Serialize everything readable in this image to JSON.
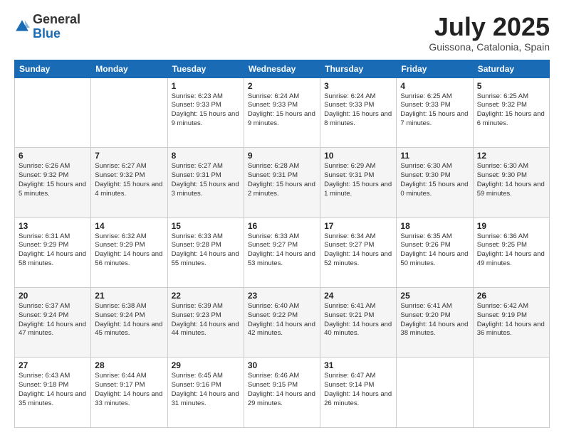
{
  "logo": {
    "general": "General",
    "blue": "Blue"
  },
  "title": "July 2025",
  "location": "Guissona, Catalonia, Spain",
  "days_of_week": [
    "Sunday",
    "Monday",
    "Tuesday",
    "Wednesday",
    "Thursday",
    "Friday",
    "Saturday"
  ],
  "weeks": [
    [
      {
        "day": "",
        "info": ""
      },
      {
        "day": "",
        "info": ""
      },
      {
        "day": "1",
        "info": "Sunrise: 6:23 AM\nSunset: 9:33 PM\nDaylight: 15 hours and 9 minutes."
      },
      {
        "day": "2",
        "info": "Sunrise: 6:24 AM\nSunset: 9:33 PM\nDaylight: 15 hours and 9 minutes."
      },
      {
        "day": "3",
        "info": "Sunrise: 6:24 AM\nSunset: 9:33 PM\nDaylight: 15 hours and 8 minutes."
      },
      {
        "day": "4",
        "info": "Sunrise: 6:25 AM\nSunset: 9:33 PM\nDaylight: 15 hours and 7 minutes."
      },
      {
        "day": "5",
        "info": "Sunrise: 6:25 AM\nSunset: 9:32 PM\nDaylight: 15 hours and 6 minutes."
      }
    ],
    [
      {
        "day": "6",
        "info": "Sunrise: 6:26 AM\nSunset: 9:32 PM\nDaylight: 15 hours and 5 minutes."
      },
      {
        "day": "7",
        "info": "Sunrise: 6:27 AM\nSunset: 9:32 PM\nDaylight: 15 hours and 4 minutes."
      },
      {
        "day": "8",
        "info": "Sunrise: 6:27 AM\nSunset: 9:31 PM\nDaylight: 15 hours and 3 minutes."
      },
      {
        "day": "9",
        "info": "Sunrise: 6:28 AM\nSunset: 9:31 PM\nDaylight: 15 hours and 2 minutes."
      },
      {
        "day": "10",
        "info": "Sunrise: 6:29 AM\nSunset: 9:31 PM\nDaylight: 15 hours and 1 minute."
      },
      {
        "day": "11",
        "info": "Sunrise: 6:30 AM\nSunset: 9:30 PM\nDaylight: 15 hours and 0 minutes."
      },
      {
        "day": "12",
        "info": "Sunrise: 6:30 AM\nSunset: 9:30 PM\nDaylight: 14 hours and 59 minutes."
      }
    ],
    [
      {
        "day": "13",
        "info": "Sunrise: 6:31 AM\nSunset: 9:29 PM\nDaylight: 14 hours and 58 minutes."
      },
      {
        "day": "14",
        "info": "Sunrise: 6:32 AM\nSunset: 9:29 PM\nDaylight: 14 hours and 56 minutes."
      },
      {
        "day": "15",
        "info": "Sunrise: 6:33 AM\nSunset: 9:28 PM\nDaylight: 14 hours and 55 minutes."
      },
      {
        "day": "16",
        "info": "Sunrise: 6:33 AM\nSunset: 9:27 PM\nDaylight: 14 hours and 53 minutes."
      },
      {
        "day": "17",
        "info": "Sunrise: 6:34 AM\nSunset: 9:27 PM\nDaylight: 14 hours and 52 minutes."
      },
      {
        "day": "18",
        "info": "Sunrise: 6:35 AM\nSunset: 9:26 PM\nDaylight: 14 hours and 50 minutes."
      },
      {
        "day": "19",
        "info": "Sunrise: 6:36 AM\nSunset: 9:25 PM\nDaylight: 14 hours and 49 minutes."
      }
    ],
    [
      {
        "day": "20",
        "info": "Sunrise: 6:37 AM\nSunset: 9:24 PM\nDaylight: 14 hours and 47 minutes."
      },
      {
        "day": "21",
        "info": "Sunrise: 6:38 AM\nSunset: 9:24 PM\nDaylight: 14 hours and 45 minutes."
      },
      {
        "day": "22",
        "info": "Sunrise: 6:39 AM\nSunset: 9:23 PM\nDaylight: 14 hours and 44 minutes."
      },
      {
        "day": "23",
        "info": "Sunrise: 6:40 AM\nSunset: 9:22 PM\nDaylight: 14 hours and 42 minutes."
      },
      {
        "day": "24",
        "info": "Sunrise: 6:41 AM\nSunset: 9:21 PM\nDaylight: 14 hours and 40 minutes."
      },
      {
        "day": "25",
        "info": "Sunrise: 6:41 AM\nSunset: 9:20 PM\nDaylight: 14 hours and 38 minutes."
      },
      {
        "day": "26",
        "info": "Sunrise: 6:42 AM\nSunset: 9:19 PM\nDaylight: 14 hours and 36 minutes."
      }
    ],
    [
      {
        "day": "27",
        "info": "Sunrise: 6:43 AM\nSunset: 9:18 PM\nDaylight: 14 hours and 35 minutes."
      },
      {
        "day": "28",
        "info": "Sunrise: 6:44 AM\nSunset: 9:17 PM\nDaylight: 14 hours and 33 minutes."
      },
      {
        "day": "29",
        "info": "Sunrise: 6:45 AM\nSunset: 9:16 PM\nDaylight: 14 hours and 31 minutes."
      },
      {
        "day": "30",
        "info": "Sunrise: 6:46 AM\nSunset: 9:15 PM\nDaylight: 14 hours and 29 minutes."
      },
      {
        "day": "31",
        "info": "Sunrise: 6:47 AM\nSunset: 9:14 PM\nDaylight: 14 hours and 26 minutes."
      },
      {
        "day": "",
        "info": ""
      },
      {
        "day": "",
        "info": ""
      }
    ]
  ]
}
